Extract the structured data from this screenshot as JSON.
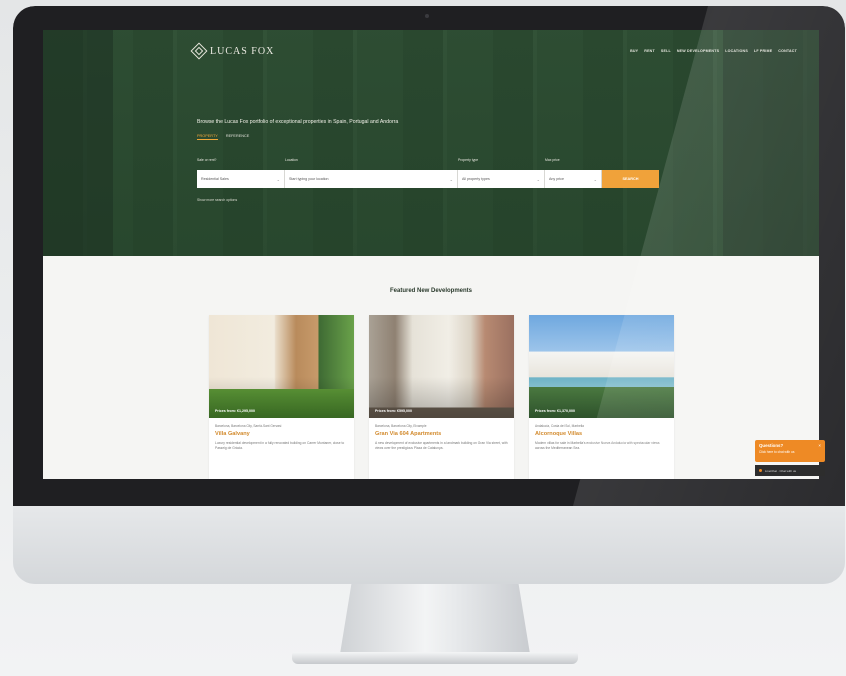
{
  "brand": {
    "logo_text": "LUCAS FOX"
  },
  "nav": {
    "links": [
      "BUY",
      "RENT",
      "SELL",
      "NEW DEVELOPMENTS",
      "LOCATIONS",
      "LF PRIME",
      "CONTACT"
    ]
  },
  "hero": {
    "title": "Browse the Lucas Fox portfolio of exceptional properties in Spain, Portugal and Andorra",
    "tabs": [
      {
        "label": "PROPERTY",
        "active": true
      },
      {
        "label": "REFERENCE",
        "active": false
      }
    ],
    "search": {
      "labels": {
        "sale_or_rent": "Sale or rent?",
        "location": "Location",
        "property_type": "Property type",
        "max_price": "Max price"
      },
      "sale_or_rent_value": "Residential Sales",
      "location_placeholder": "Start typing your location",
      "property_type_value": "All property types",
      "max_price_value": "Any price",
      "button_label": "SEARCH"
    },
    "advanced_link": "Show more search options"
  },
  "featured": {
    "title": "Featured New Developments",
    "cards": [
      {
        "price": "Prices from: €1,295,000",
        "location": "Barcelona, Barcelona City, Sarrià-Sant Gervasi",
        "name": "Villa Galvany",
        "description": "Luxury residential development in a fully renovated building on Carrer Muntaner, close to Passeig de Gràcia."
      },
      {
        "price": "Prices from: €595,000",
        "location": "Barcelona, Barcelona City, Eixample",
        "name": "Gran Via 604 Apartments",
        "description": "A new development of exclusive apartments in a landmark building on Gran Via street, with views over the prestigious Plaza de Catalunya."
      },
      {
        "price": "Prices from: €1,370,000",
        "location": "Andalucía, Costa del Sol, Marbella",
        "name": "Alcornoque Villas",
        "description": "Modern villas for sale in Marbella's exclusive Nueva Andalucía with spectacular views across the Mediterranean Sea."
      }
    ]
  },
  "chat": {
    "title": "Questions?",
    "subtitle": "Click here to chat with us",
    "close": "×",
    "status": "LiveChat · Chat with us"
  },
  "colors": {
    "accent": "#f0a23a",
    "brand_green": "#2c4a32",
    "card_title": "#d28a2d"
  }
}
